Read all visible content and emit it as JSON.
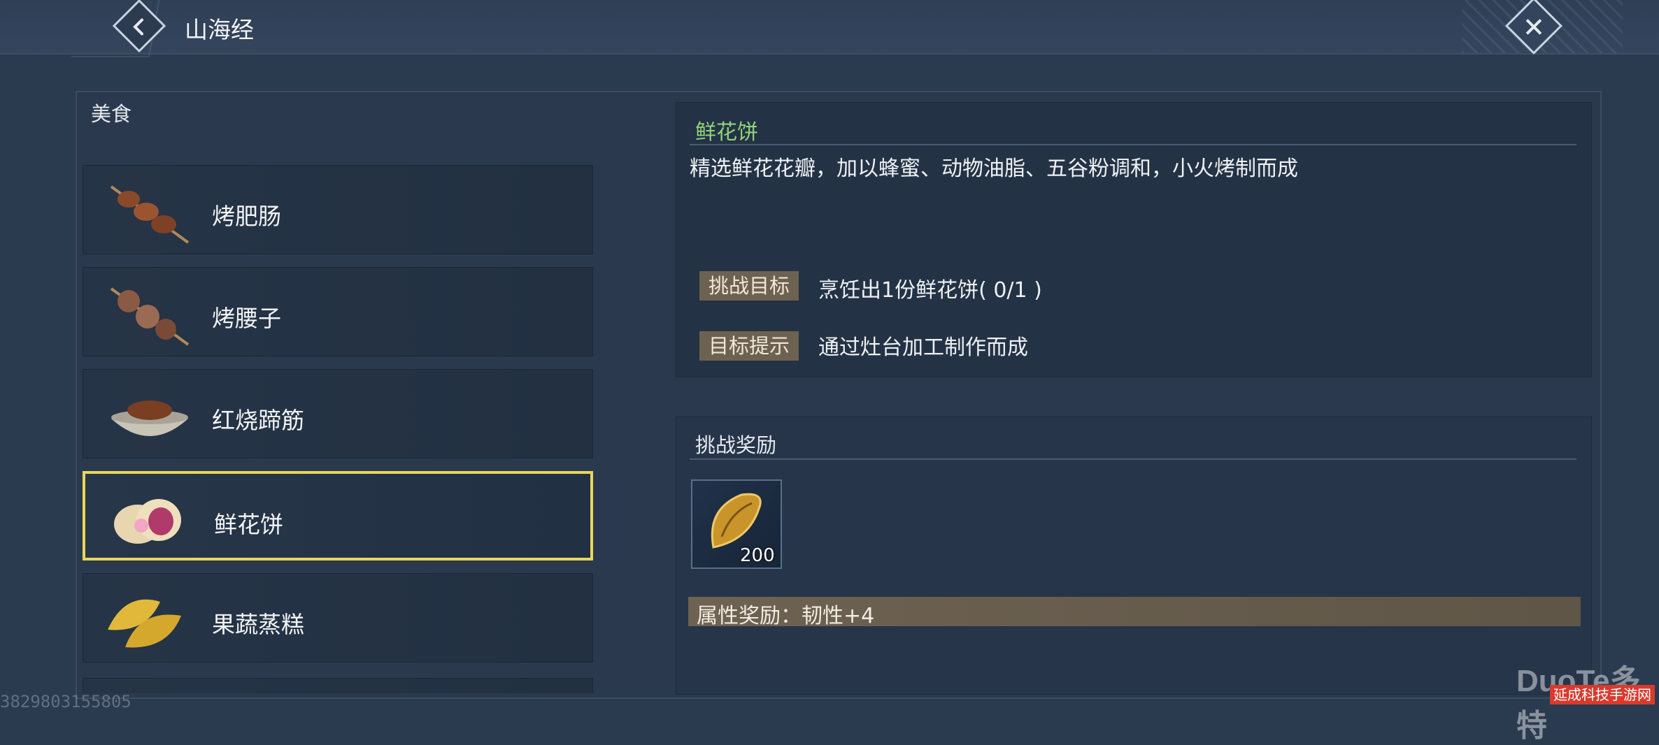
{
  "header": {
    "title": "山海经"
  },
  "category": {
    "label": "美食"
  },
  "food_list": [
    {
      "name": "烤肥肠",
      "icon": "skewer-intestine-icon"
    },
    {
      "name": "烤腰子",
      "icon": "skewer-kidney-icon"
    },
    {
      "name": "红烧蹄筋",
      "icon": "braised-tendon-bowl-icon"
    },
    {
      "name": "鲜花饼",
      "icon": "flower-cake-icon",
      "selected": true
    },
    {
      "name": "果蔬蒸糕",
      "icon": "steamed-dumpling-icon"
    }
  ],
  "detail": {
    "name": "鲜花饼",
    "description": "精选鲜花花瓣，加以蜂蜜、动物油脂、五谷粉调和，小火烤制而成",
    "goal_tag": "挑战目标",
    "goal_text": "烹饪出1份鲜花饼( 0/1 )",
    "hint_tag": "目标提示",
    "hint_text": "通过灶台加工制作而成"
  },
  "reward": {
    "title": "挑战奖励",
    "item_icon": "golden-seed-icon",
    "count": "200",
    "attribute": "属性奖励：韧性+4"
  },
  "watermark": {
    "id_text": "3829803155805",
    "logo": "DuoTe多特",
    "badge": "延成科技手游网"
  }
}
